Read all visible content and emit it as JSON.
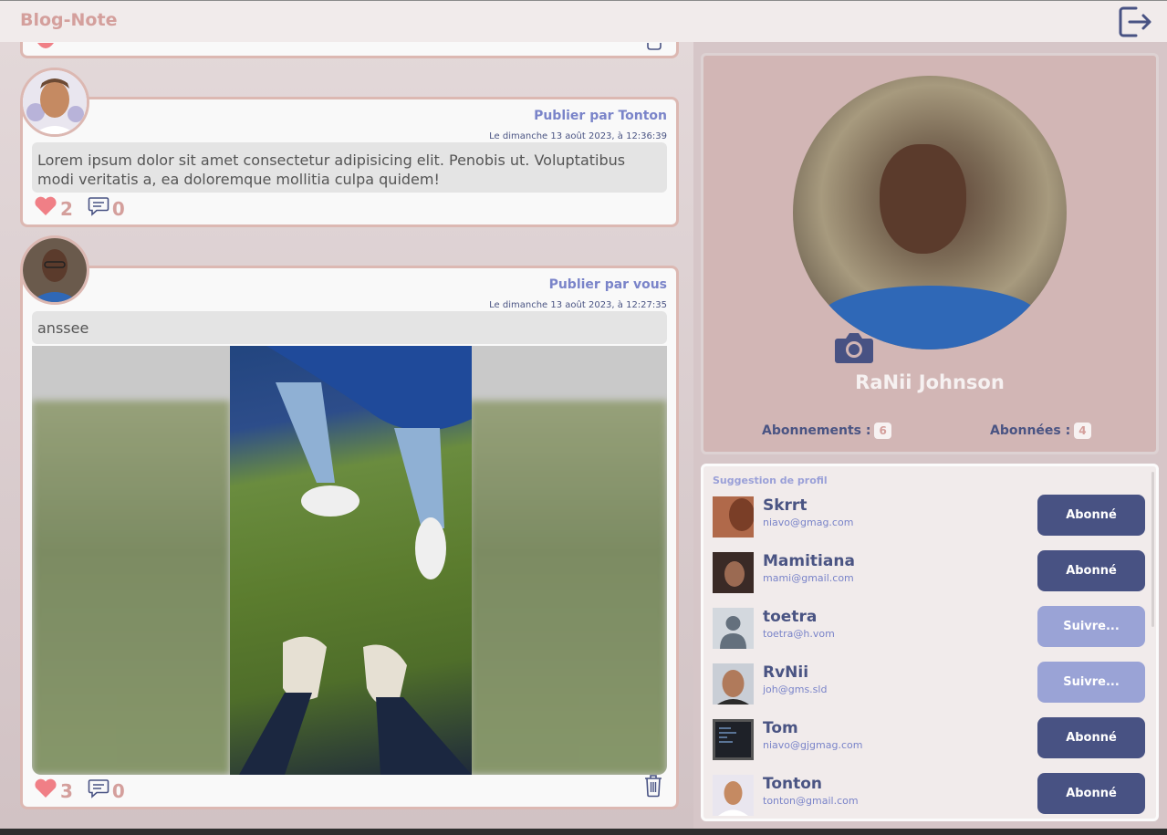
{
  "app": {
    "title": "Blog-Note"
  },
  "header": {
    "logout_icon": "logout-icon"
  },
  "posts": [
    {
      "author_line": "Publier par Tonton",
      "date": "Le dimanche 13 août 2023, à 12:36:39",
      "content": "Lorem ipsum dolor sit amet consectetur adipisicing elit. Penobis ut. Voluptatibus modi veritatis a, ea doloremque mollitia culpa quidem!",
      "likes": "2",
      "comments": "0"
    },
    {
      "author_line": "Publier par vous",
      "date": "Le dimanche 13 août 2023, à 12:27:35",
      "content": "anssee",
      "likes": "3",
      "comments": "0"
    }
  ],
  "profile": {
    "name": "RaNii Johnson",
    "following_label": "Abonnements :",
    "following_count": "6",
    "followers_label": "Abonnées :",
    "followers_count": "4"
  },
  "suggestions": {
    "title": "Suggestion de profil",
    "items": [
      {
        "name": "Skrrt",
        "email": "niavo@gmag.com",
        "button": "Abonné",
        "state": "on"
      },
      {
        "name": "Mamitiana",
        "email": "mami@gmail.com",
        "button": "Abonné",
        "state": "on"
      },
      {
        "name": "toetra",
        "email": "toetra@h.vom",
        "button": "Suivre...",
        "state": "off"
      },
      {
        "name": "RvNii",
        "email": "joh@gms.sld",
        "button": "Suivre...",
        "state": "off"
      },
      {
        "name": "Tom",
        "email": "niavo@gjgmag.com",
        "button": "Abonné",
        "state": "on"
      },
      {
        "name": "Tonton",
        "email": "tonton@gmail.com",
        "button": "Abonné",
        "state": "on"
      }
    ]
  },
  "colors": {
    "accent": "#485283",
    "heart": "#f07f86",
    "muted_pink": "#d49f9c"
  }
}
